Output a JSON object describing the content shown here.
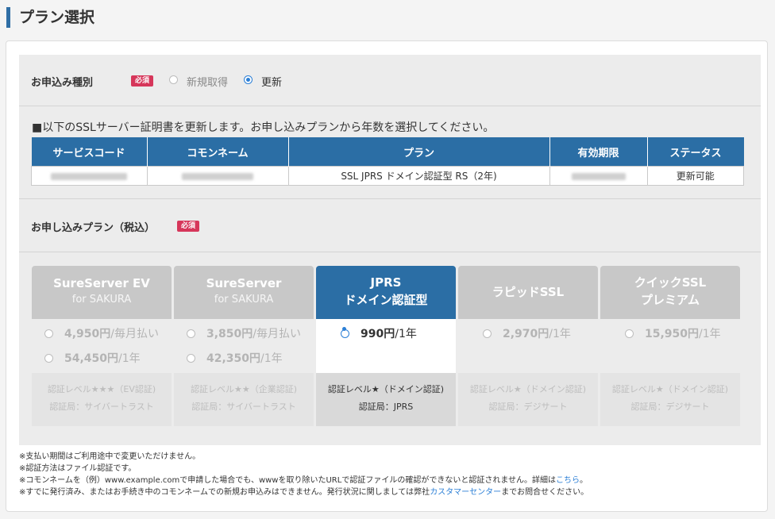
{
  "page_title": "プラン選択",
  "application_type": {
    "label": "お申込み種別",
    "required": "必須",
    "options": [
      {
        "label": "新規取得",
        "selected": false
      },
      {
        "label": "更新",
        "selected": true
      }
    ]
  },
  "renewal": {
    "notice": "■以下のSSLサーバー証明書を更新します。お申し込みプランから年数を選択してください。",
    "columns": [
      "サービスコード",
      "コモンネーム",
      "プラン",
      "有効期限",
      "ステータス"
    ],
    "row": {
      "plan": "SSL JPRS ドメイン認証型 RS（2年)",
      "status": "更新可能"
    }
  },
  "plan_section": {
    "label": "お申し込みプラン（税込）",
    "required": "必須"
  },
  "plans": [
    {
      "name_line1": "SureServer EV",
      "name_line2": "for SAKURA",
      "prices": [
        {
          "amount": "4,950円",
          "unit": "/毎月払い"
        },
        {
          "amount": "54,450円",
          "unit": "/1年"
        }
      ],
      "level": "認証レベル★★★（EV認証)",
      "issuer": "認証局：サイバートラスト",
      "selected": false
    },
    {
      "name_line1": "SureServer",
      "name_line2": "for SAKURA",
      "prices": [
        {
          "amount": "3,850円",
          "unit": "/毎月払い"
        },
        {
          "amount": "42,350円",
          "unit": "/1年"
        }
      ],
      "level": "認証レベル★★（企業認証)",
      "issuer": "認証局：サイバートラスト",
      "selected": false
    },
    {
      "name_line1": "JPRS",
      "name_line2": "ドメイン認証型",
      "prices": [
        {
          "amount": "990円",
          "unit": "/1年"
        }
      ],
      "level": "認証レベル★（ドメイン認証)",
      "issuer": "認証局：JPRS",
      "selected": true
    },
    {
      "name_line1": "ラピッドSSL",
      "name_line2": "",
      "prices": [
        {
          "amount": "2,970円",
          "unit": "/1年"
        }
      ],
      "level": "認証レベル★（ドメイン認証)",
      "issuer": "認証局：デジサート",
      "selected": false
    },
    {
      "name_line1": "クイックSSL",
      "name_line2": "プレミアム",
      "prices": [
        {
          "amount": "15,950円",
          "unit": "/1年"
        }
      ],
      "level": "認証レベル★（ドメイン認証)",
      "issuer": "認証局：デジサート",
      "selected": false
    }
  ],
  "notes": {
    "line1": "※支払い期間はご利用途中で変更いただけません。",
    "line2": "※認証方法はファイル認証です。",
    "line3_text": "※コモンネームを（例）www.example.comで申請した場合でも、wwwを取り除いたURLで認証ファイルの確認ができないと認証されません。詳細は",
    "line3_link": "こちら",
    "line3_end": "。",
    "line4_text": "※すでに発行済み、またはお手続き中のコモンネームでの新規お申込みはできません。発行状況に関しましては弊社",
    "line4_link": "カスタマーセンター",
    "line4_end": "までお問合せください。"
  },
  "colors": {
    "accent": "#2b6ea5",
    "required_badge": "#d6365a",
    "status_ok": "#d8251f",
    "link": "#2b7fd6"
  }
}
